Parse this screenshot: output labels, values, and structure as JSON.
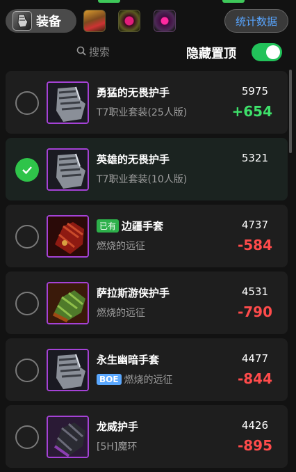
{
  "header": {
    "category_tab_label": "装备",
    "stats_button_label": "统计数据"
  },
  "search": {
    "placeholder": "搜索",
    "hide_top_label": "隐藏置顶",
    "hide_top_enabled": true
  },
  "colors": {
    "accent_green": "#22c25a",
    "positive": "#3ee06a",
    "negative": "#ff4b4b",
    "epic_border": "#a542d6",
    "link_blue": "#58a5ff"
  },
  "items": [
    {
      "name": "勇猛的无畏护手",
      "source": "T7职业套装(25人版)",
      "score": "5975",
      "diff": "+654",
      "badge": "",
      "selected": false,
      "icon": "plate-gauntlet-icon"
    },
    {
      "name": "英雄的无畏护手",
      "source": "T7职业套装(10人版)",
      "score": "5321",
      "diff": "",
      "badge": "",
      "selected": true,
      "icon": "plate-gauntlet-icon"
    },
    {
      "name": "边疆手套",
      "source": "燃烧的远征",
      "score": "4737",
      "diff": "-584",
      "badge": "已有",
      "selected": false,
      "icon": "red-glove-icon"
    },
    {
      "name": "萨拉斯游侠护手",
      "source": "燃烧的远征",
      "score": "4531",
      "diff": "-790",
      "badge": "",
      "selected": false,
      "icon": "green-glove-icon"
    },
    {
      "name": "永生幽暗手套",
      "source": "燃烧的远征",
      "score": "4477",
      "diff": "-844",
      "badge": "BOE",
      "selected": false,
      "icon": "plate-gauntlet-icon"
    },
    {
      "name": "龙威护手",
      "source": "[5H]魔环",
      "score": "4426",
      "diff": "-895",
      "badge": "",
      "selected": false,
      "icon": "dark-glove-icon"
    }
  ]
}
